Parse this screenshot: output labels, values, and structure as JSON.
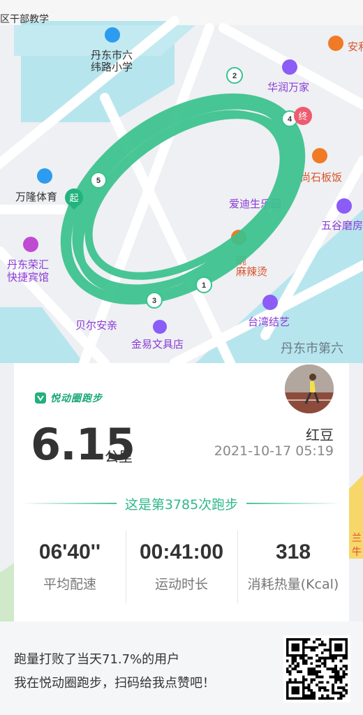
{
  "map": {
    "labels": [
      {
        "key": "school",
        "text": "丹东市六\n纬路小学"
      },
      {
        "key": "huarun",
        "text": "华润万家"
      },
      {
        "key": "anke",
        "text": "安利"
      },
      {
        "key": "shiban",
        "text": "尚石板饭"
      },
      {
        "key": "wanlong",
        "text": "万隆体育"
      },
      {
        "key": "aidi",
        "text": "爱迪生乐园"
      },
      {
        "key": "wugu",
        "text": "五谷磨房"
      },
      {
        "key": "rongbin",
        "text": "丹东荣汇\n快捷宾馆"
      },
      {
        "key": "malatang",
        "text": "碗麻辣烫"
      },
      {
        "key": "taiwan",
        "text": "台湾结艺"
      },
      {
        "key": "beier",
        "text": "贝尔安亲"
      },
      {
        "key": "jinyi",
        "text": "金易文具店"
      },
      {
        "key": "dandong6",
        "text": "丹东市第六"
      },
      {
        "key": "topleft",
        "text": "区干部教学"
      },
      {
        "key": "right_edge",
        "text": "兰 牛"
      }
    ],
    "markers": {
      "start": "起",
      "end": "终",
      "km": [
        "1",
        "2",
        "3",
        "4",
        "5"
      ]
    }
  },
  "card": {
    "brand": "悦动圈跑步",
    "distance": "6.15",
    "unit": "公里",
    "username": "红豆",
    "datetime": "2021-10-17 05:19",
    "run_count_text": "这是第3785次跑步",
    "stats": [
      {
        "value": "06'40''",
        "label": "平均配速"
      },
      {
        "value": "00:41:00",
        "label": "运动时长"
      },
      {
        "value": "318",
        "label": "消耗热量(Kcal)"
      }
    ]
  },
  "footer": {
    "line1": "跑量打败了当天71.7%的用户",
    "line2": "我在悦动圈跑步，扫码给我点赞吧！"
  },
  "colors": {
    "accent": "#46c497",
    "route": "#3ac28e"
  }
}
